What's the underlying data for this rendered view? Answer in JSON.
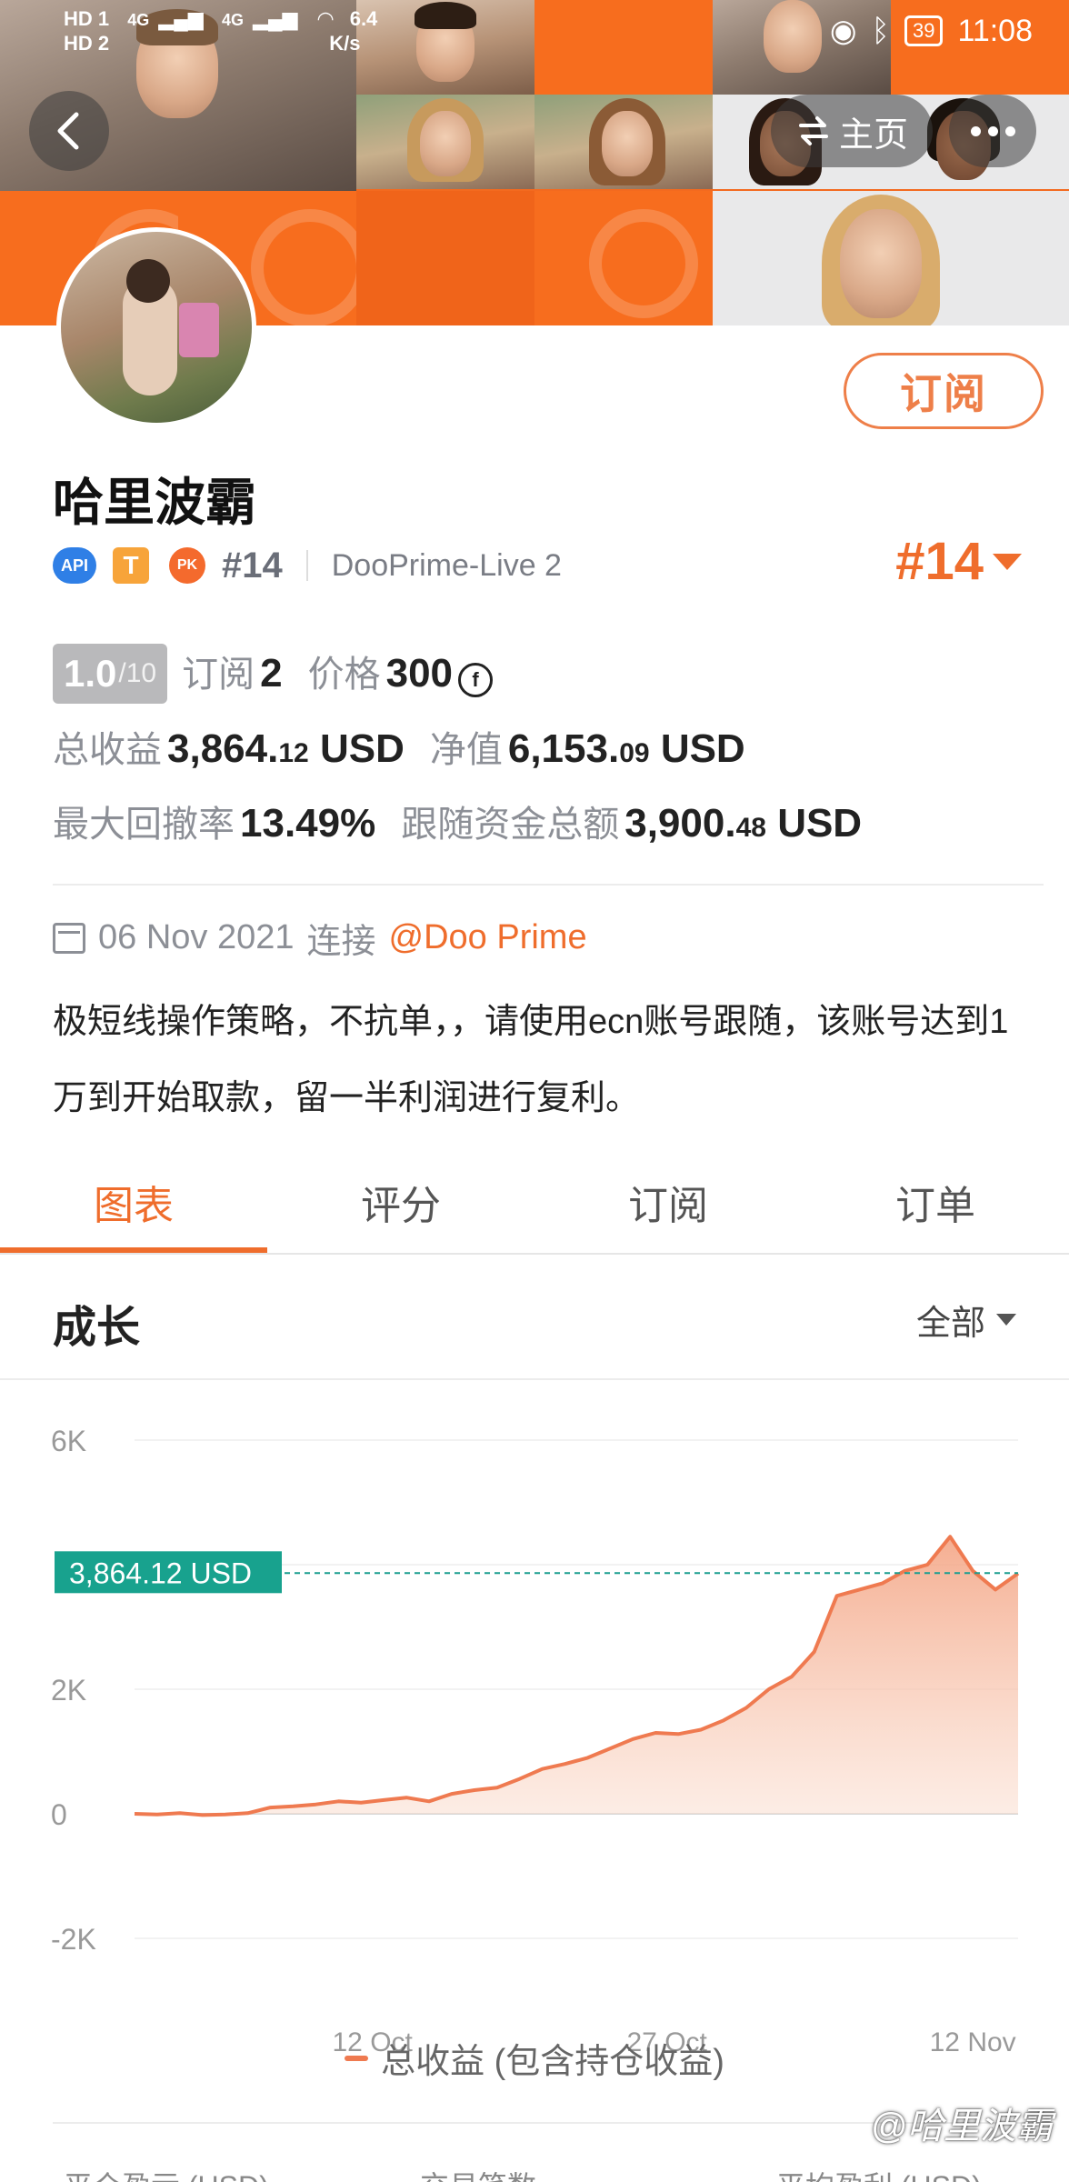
{
  "status_bar": {
    "network_1": "HD 1",
    "network_2": "HD 2",
    "signal_1": "4G",
    "signal_2": "4G",
    "speed_value": "6.4",
    "speed_unit": "K/s",
    "battery": "39",
    "time": "11:08"
  },
  "nav": {
    "home_label": "主页"
  },
  "profile": {
    "subscribe_label": "订阅",
    "name": "哈里波霸",
    "badge_api": "API",
    "badge_t": "T",
    "badge_pk": "PK",
    "rank_small": "#14",
    "server": "DooPrime-Live 2",
    "rank_big": "#14"
  },
  "stats": {
    "score_value": "1.0",
    "score_max": "/10",
    "subscribe_label": "订阅",
    "subscribe_count": "2",
    "price_label": "价格",
    "price_value": "300",
    "coin_symbol": "f",
    "total_profit_label": "总收益",
    "total_profit_int": "3,864.",
    "total_profit_dec": "12",
    "total_profit_unit": "USD",
    "equity_label": "净值",
    "equity_int": "6,153.",
    "equity_dec": "09",
    "equity_unit": "USD",
    "drawdown_label": "最大回撤率",
    "drawdown_value": "13.49%",
    "follow_funds_label": "跟随资金总额",
    "follow_funds_int": "3,900.",
    "follow_funds_dec": "48",
    "follow_funds_unit": "USD"
  },
  "info": {
    "date": "06 Nov 2021",
    "connect_label": "连接",
    "broker_link": "@Doo Prime",
    "description": "极短线操作策略，不抗单，，请使用ecn账号跟随，该账号达到1万到开始取款，留一半利润进行复利。"
  },
  "tabs": [
    {
      "label": "图表",
      "active": true
    },
    {
      "label": "评分",
      "active": false
    },
    {
      "label": "订阅",
      "active": false
    },
    {
      "label": "订单",
      "active": false
    }
  ],
  "section": {
    "title": "成长",
    "filter_label": "全部"
  },
  "chart_data": {
    "type": "area",
    "y_ticks": [
      "6K",
      "2K",
      "0",
      "-2K"
    ],
    "x_ticks": [
      "12 Oct",
      "27 Oct",
      "12 Nov"
    ],
    "ylim": [
      -2000,
      6000
    ],
    "current_value_label": "3,864.12 USD",
    "current_value": 3864.12,
    "series": [
      {
        "name": "总收益 (包含持仓收益)",
        "color": "#ef7a50",
        "x": [
          "27 Sep",
          "29 Sep",
          "1 Oct",
          "3 Oct",
          "5 Oct",
          "7 Oct",
          "9 Oct",
          "11 Oct",
          "13 Oct",
          "14 Oct",
          "15 Oct",
          "16 Oct",
          "17 Oct",
          "18 Oct",
          "19 Oct",
          "20 Oct",
          "21 Oct",
          "22 Oct",
          "23 Oct",
          "24 Oct",
          "25 Oct",
          "26 Oct",
          "27 Oct",
          "28 Oct",
          "29 Oct",
          "30 Oct",
          "31 Oct",
          "1 Nov",
          "2 Nov",
          "3 Nov",
          "4 Nov",
          "5 Nov",
          "6 Nov",
          "7 Nov",
          "8 Nov",
          "9 Nov",
          "10 Nov",
          "11 Nov",
          "12 Nov",
          "13 Nov"
        ],
        "values": [
          0,
          -10,
          10,
          -20,
          -10,
          10,
          100,
          120,
          150,
          200,
          180,
          220,
          260,
          200,
          320,
          380,
          420,
          560,
          720,
          800,
          900,
          1050,
          1200,
          1300,
          1280,
          1350,
          1500,
          1700,
          2000,
          2200,
          2600,
          3500,
          3600,
          3700,
          3900,
          4000,
          4450,
          3900,
          3600,
          3860
        ]
      }
    ],
    "legend_position": "bottom-center",
    "grid": true
  },
  "footer": {
    "stat_1": "平仓盈亏 (USD)",
    "stat_2": "交易笔数",
    "stat_3": "平均盈利 (USD)",
    "watermark": "@哈里波霸"
  }
}
